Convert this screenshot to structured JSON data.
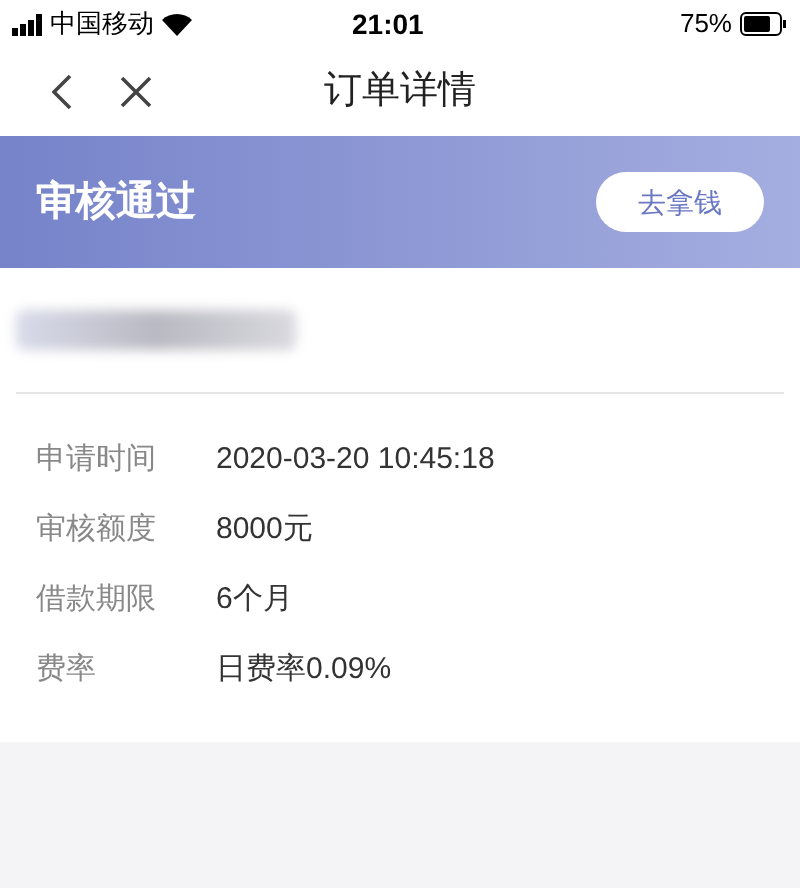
{
  "status_bar": {
    "carrier": "中国移动",
    "time": "21:01",
    "battery": "75%"
  },
  "nav": {
    "title": "订单详情"
  },
  "banner": {
    "status": "审核通过",
    "button": "去拿钱"
  },
  "details": [
    {
      "label": "申请时间",
      "value": "2020-03-20 10:45:18"
    },
    {
      "label": "审核额度",
      "value": "8000元"
    },
    {
      "label": "借款期限",
      "value": "6个月"
    },
    {
      "label": "费率",
      "value": "日费率0.09%"
    }
  ]
}
